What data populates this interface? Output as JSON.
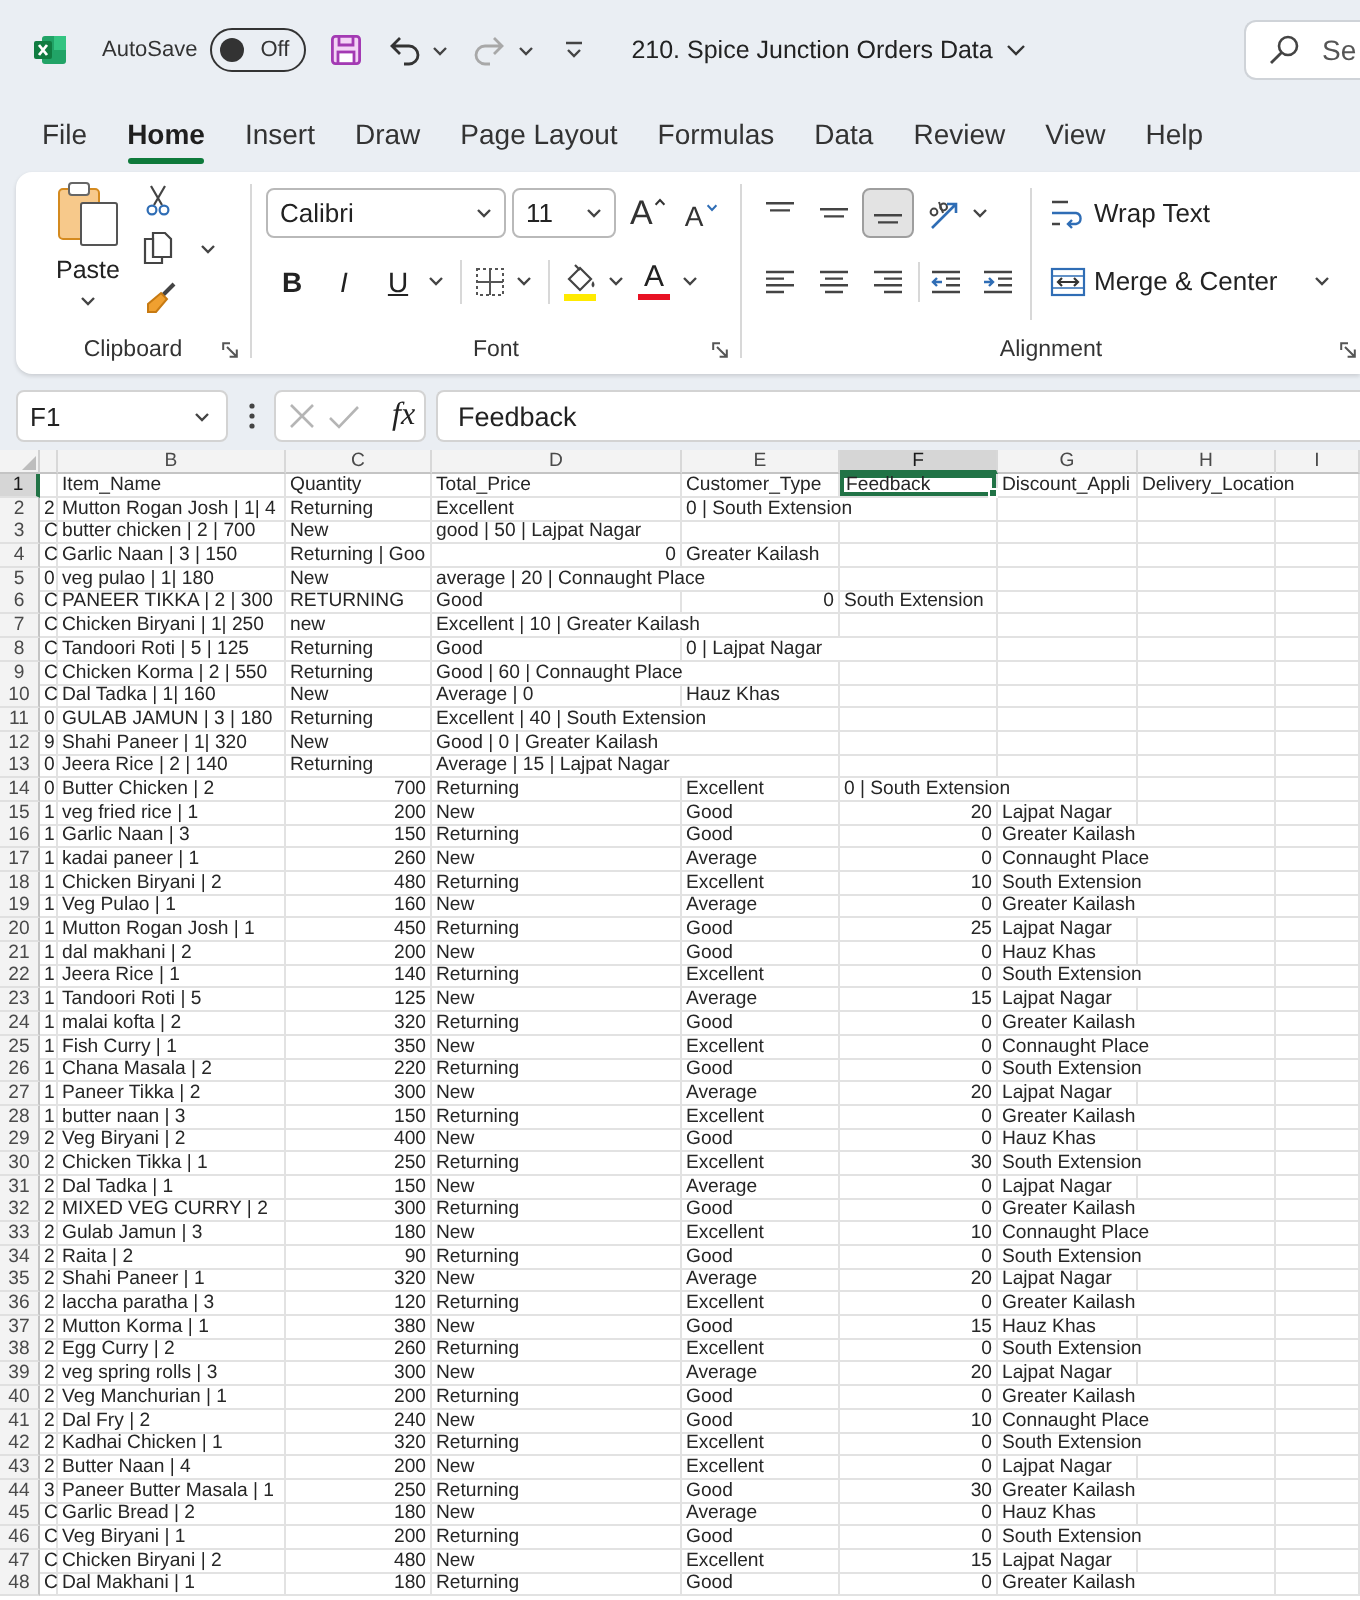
{
  "title_bar": {
    "autosave": {
      "label": "AutoSave",
      "on": false,
      "state_text": "Off"
    },
    "quick_access": [
      {
        "kind": "save",
        "disabled": false
      },
      {
        "kind": "undo",
        "disabled": false
      },
      {
        "kind": "redo",
        "disabled": true
      }
    ],
    "document_title": "210. Spice Junction Orders Data",
    "search": {
      "placeholder": "Se"
    }
  },
  "tabs": [
    {
      "label": "File",
      "selected": false
    },
    {
      "label": "Home",
      "selected": true
    },
    {
      "label": "Insert",
      "selected": false
    },
    {
      "label": "Draw",
      "selected": false
    },
    {
      "label": "Page Layout",
      "selected": false
    },
    {
      "label": "Formulas",
      "selected": false
    },
    {
      "label": "Data",
      "selected": false
    },
    {
      "label": "Review",
      "selected": false
    },
    {
      "label": "View",
      "selected": false
    },
    {
      "label": "Help",
      "selected": false
    }
  ],
  "ribbon": {
    "clipboard": {
      "paste_label": "Paste",
      "group_label": "Clipboard"
    },
    "font": {
      "font_name": "Calibri",
      "font_size": "11",
      "size_buttons": [
        {
          "kind": "grow",
          "label": "A"
        },
        {
          "kind": "shrink",
          "label": "A"
        }
      ],
      "style_buttons": [
        {
          "kind": "bold",
          "label": "B"
        },
        {
          "kind": "italic",
          "label": "I"
        },
        {
          "kind": "underline",
          "label": "U"
        }
      ],
      "font_color_label": "A",
      "group_label": "Font"
    },
    "alignment": {
      "vertical": [
        {
          "kind": "top",
          "selected": false
        },
        {
          "kind": "middle",
          "selected": false
        },
        {
          "kind": "bottom",
          "selected": true
        }
      ],
      "wrap_text": "Wrap Text",
      "merge_center": "Merge & Center",
      "group_label": "Alignment"
    }
  },
  "formula_bar": {
    "name_box": "F1",
    "buttons": [
      {
        "kind": "cancel",
        "disabled": true
      },
      {
        "kind": "enter",
        "disabled": true
      },
      {
        "kind": "function",
        "label": "fx",
        "disabled": false
      }
    ],
    "value": "Feedback"
  },
  "sheet": {
    "columns": [
      {
        "selected": false
      },
      {
        "label": "B",
        "selected": false
      },
      {
        "label": "C",
        "selected": false
      },
      {
        "label": "D",
        "selected": false
      },
      {
        "label": "E",
        "selected": false
      },
      {
        "label": "F",
        "selected": true
      },
      {
        "label": "G",
        "selected": false
      },
      {
        "label": "H",
        "selected": false
      },
      {
        "label": "I",
        "selected": false
      }
    ],
    "rows": [
      {
        "label": "1",
        "selected": true,
        "cells": [
          null,
          {
            "kind": "text",
            "text": "Item_Name"
          },
          {
            "kind": "text",
            "text": "Quantity"
          },
          {
            "kind": "text",
            "text": "Total_Price"
          },
          {
            "kind": "text",
            "text": "Customer_Type"
          },
          {
            "kind": "text",
            "text": "Feedback"
          },
          {
            "kind": "text",
            "text": "Discount_Appli"
          },
          {
            "kind": "text",
            "text": "Delivery_Location"
          }
        ]
      },
      {
        "label": "2",
        "selected": false,
        "cells": [
          {
            "kind": "text",
            "text": "2"
          },
          {
            "kind": "text",
            "text": "Mutton Rogan Josh | 1| 4"
          },
          {
            "kind": "text",
            "text": "Returning"
          },
          {
            "kind": "text",
            "text": "Excellent"
          },
          {
            "kind": "text",
            "text": "0 | South Extension"
          }
        ]
      },
      {
        "label": "3",
        "selected": false,
        "cells": [
          {
            "kind": "text",
            "text": "C"
          },
          {
            "kind": "text",
            "text": "butter chicken | 2 | 700"
          },
          {
            "kind": "text",
            "text": "New"
          },
          {
            "kind": "text",
            "text": "good | 50 | Lajpat Nagar"
          }
        ]
      },
      {
        "label": "4",
        "selected": false,
        "cells": [
          {
            "kind": "text",
            "text": "C"
          },
          {
            "kind": "text",
            "text": "Garlic Naan | 3 | 150"
          },
          {
            "kind": "text",
            "text": "Returning | Goo"
          },
          {
            "kind": "number",
            "text": "0"
          },
          {
            "kind": "text",
            "text": "Greater Kailash"
          }
        ]
      },
      {
        "label": "5",
        "selected": false,
        "cells": [
          {
            "kind": "text",
            "text": "0"
          },
          {
            "kind": "text",
            "text": "veg pulao | 1| 180"
          },
          {
            "kind": "text",
            "text": "New"
          },
          {
            "kind": "text",
            "text": "average | 20 | Connaught Place"
          }
        ]
      },
      {
        "label": "6",
        "selected": false,
        "cells": [
          {
            "kind": "text",
            "text": "C"
          },
          {
            "kind": "text",
            "text": "PANEER TIKKA | 2 | 300"
          },
          {
            "kind": "text",
            "text": "RETURNING"
          },
          {
            "kind": "text",
            "text": "Good"
          },
          {
            "kind": "number",
            "text": "0"
          },
          {
            "kind": "text",
            "text": "South Extension"
          }
        ]
      },
      {
        "label": "7",
        "selected": false,
        "cells": [
          {
            "kind": "text",
            "text": "C"
          },
          {
            "kind": "text",
            "text": "Chicken Biryani | 1| 250"
          },
          {
            "kind": "text",
            "text": "new"
          },
          {
            "kind": "text",
            "text": "Excellent | 10 | Greater Kailash"
          }
        ]
      },
      {
        "label": "8",
        "selected": false,
        "cells": [
          {
            "kind": "text",
            "text": "C"
          },
          {
            "kind": "text",
            "text": "Tandoori Roti | 5 | 125"
          },
          {
            "kind": "text",
            "text": "Returning"
          },
          {
            "kind": "text",
            "text": "Good"
          },
          {
            "kind": "text",
            "text": "0 | Lajpat Nagar"
          }
        ]
      },
      {
        "label": "9",
        "selected": false,
        "cells": [
          {
            "kind": "text",
            "text": "C"
          },
          {
            "kind": "text",
            "text": "Chicken Korma | 2 | 550"
          },
          {
            "kind": "text",
            "text": "Returning"
          },
          {
            "kind": "text",
            "text": "Good | 60 | Connaught Place"
          }
        ]
      },
      {
        "label": "10",
        "selected": false,
        "cells": [
          {
            "kind": "text",
            "text": "C"
          },
          {
            "kind": "text",
            "text": "Dal Tadka | 1| 160"
          },
          {
            "kind": "text",
            "text": "New"
          },
          {
            "kind": "text",
            "text": "Average | 0"
          },
          {
            "kind": "text",
            "text": "Hauz Khas"
          }
        ]
      },
      {
        "label": "11",
        "selected": false,
        "cells": [
          {
            "kind": "text",
            "text": "0"
          },
          {
            "kind": "text",
            "text": "GULAB JAMUN | 3 | 180"
          },
          {
            "kind": "text",
            "text": "Returning"
          },
          {
            "kind": "text",
            "text": "Excellent | 40 | South Extension"
          }
        ]
      },
      {
        "label": "12",
        "selected": false,
        "cells": [
          {
            "kind": "text",
            "text": "9"
          },
          {
            "kind": "text",
            "text": "Shahi Paneer | 1| 320"
          },
          {
            "kind": "text",
            "text": "New"
          },
          {
            "kind": "text",
            "text": "Good | 0 | Greater Kailash"
          }
        ]
      },
      {
        "label": "13",
        "selected": false,
        "cells": [
          {
            "kind": "text",
            "text": "0"
          },
          {
            "kind": "text",
            "text": "Jeera Rice | 2 | 140"
          },
          {
            "kind": "text",
            "text": "Returning"
          },
          {
            "kind": "text",
            "text": "Average | 15 | Lajpat Nagar"
          }
        ]
      },
      {
        "label": "14",
        "selected": false,
        "cells": [
          {
            "kind": "text",
            "text": "0"
          },
          {
            "kind": "text",
            "text": "Butter Chicken | 2"
          },
          {
            "kind": "number",
            "text": "700"
          },
          {
            "kind": "text",
            "text": "Returning"
          },
          {
            "kind": "text",
            "text": "Excellent"
          },
          {
            "kind": "text",
            "text": "0 | South Extension"
          }
        ]
      },
      {
        "label": "15",
        "selected": false,
        "cells": [
          {
            "kind": "text",
            "text": "1"
          },
          {
            "kind": "text",
            "text": "veg fried rice | 1"
          },
          {
            "kind": "number",
            "text": "200"
          },
          {
            "kind": "text",
            "text": "New"
          },
          {
            "kind": "text",
            "text": "Good"
          },
          {
            "kind": "number",
            "text": "20"
          },
          {
            "kind": "text",
            "text": "Lajpat Nagar"
          }
        ]
      },
      {
        "label": "16",
        "selected": false,
        "cells": [
          {
            "kind": "text",
            "text": "1"
          },
          {
            "kind": "text",
            "text": "Garlic Naan | 3"
          },
          {
            "kind": "number",
            "text": "150"
          },
          {
            "kind": "text",
            "text": "Returning"
          },
          {
            "kind": "text",
            "text": "Good"
          },
          {
            "kind": "number",
            "text": "0"
          },
          {
            "kind": "text",
            "text": "Greater Kailash"
          }
        ]
      },
      {
        "label": "17",
        "selected": false,
        "cells": [
          {
            "kind": "text",
            "text": "1"
          },
          {
            "kind": "text",
            "text": "kadai paneer | 1"
          },
          {
            "kind": "number",
            "text": "260"
          },
          {
            "kind": "text",
            "text": "New"
          },
          {
            "kind": "text",
            "text": "Average"
          },
          {
            "kind": "number",
            "text": "0"
          },
          {
            "kind": "text",
            "text": "Connaught Place"
          }
        ]
      },
      {
        "label": "18",
        "selected": false,
        "cells": [
          {
            "kind": "text",
            "text": "1"
          },
          {
            "kind": "text",
            "text": "Chicken Biryani | 2"
          },
          {
            "kind": "number",
            "text": "480"
          },
          {
            "kind": "text",
            "text": "Returning"
          },
          {
            "kind": "text",
            "text": "Excellent"
          },
          {
            "kind": "number",
            "text": "10"
          },
          {
            "kind": "text",
            "text": "South Extension"
          }
        ]
      },
      {
        "label": "19",
        "selected": false,
        "cells": [
          {
            "kind": "text",
            "text": "1"
          },
          {
            "kind": "text",
            "text": "Veg Pulao | 1"
          },
          {
            "kind": "number",
            "text": "160"
          },
          {
            "kind": "text",
            "text": "New"
          },
          {
            "kind": "text",
            "text": "Average"
          },
          {
            "kind": "number",
            "text": "0"
          },
          {
            "kind": "text",
            "text": "Greater Kailash"
          }
        ]
      },
      {
        "label": "20",
        "selected": false,
        "cells": [
          {
            "kind": "text",
            "text": "1"
          },
          {
            "kind": "text",
            "text": "Mutton Rogan Josh | 1"
          },
          {
            "kind": "number",
            "text": "450"
          },
          {
            "kind": "text",
            "text": "Returning"
          },
          {
            "kind": "text",
            "text": "Good"
          },
          {
            "kind": "number",
            "text": "25"
          },
          {
            "kind": "text",
            "text": "Lajpat Nagar"
          }
        ]
      },
      {
        "label": "21",
        "selected": false,
        "cells": [
          {
            "kind": "text",
            "text": "1"
          },
          {
            "kind": "text",
            "text": "dal makhani | 2"
          },
          {
            "kind": "number",
            "text": "200"
          },
          {
            "kind": "text",
            "text": "New"
          },
          {
            "kind": "text",
            "text": "Good"
          },
          {
            "kind": "number",
            "text": "0"
          },
          {
            "kind": "text",
            "text": "Hauz Khas"
          }
        ]
      },
      {
        "label": "22",
        "selected": false,
        "cells": [
          {
            "kind": "text",
            "text": "1"
          },
          {
            "kind": "text",
            "text": "Jeera Rice | 1"
          },
          {
            "kind": "number",
            "text": "140"
          },
          {
            "kind": "text",
            "text": "Returning"
          },
          {
            "kind": "text",
            "text": "Excellent"
          },
          {
            "kind": "number",
            "text": "0"
          },
          {
            "kind": "text",
            "text": "South Extension"
          }
        ]
      },
      {
        "label": "23",
        "selected": false,
        "cells": [
          {
            "kind": "text",
            "text": "1"
          },
          {
            "kind": "text",
            "text": "Tandoori Roti | 5"
          },
          {
            "kind": "number",
            "text": "125"
          },
          {
            "kind": "text",
            "text": "New"
          },
          {
            "kind": "text",
            "text": "Average"
          },
          {
            "kind": "number",
            "text": "15"
          },
          {
            "kind": "text",
            "text": "Lajpat Nagar"
          }
        ]
      },
      {
        "label": "24",
        "selected": false,
        "cells": [
          {
            "kind": "text",
            "text": "1"
          },
          {
            "kind": "text",
            "text": "malai kofta | 2"
          },
          {
            "kind": "number",
            "text": "320"
          },
          {
            "kind": "text",
            "text": "Returning"
          },
          {
            "kind": "text",
            "text": "Good"
          },
          {
            "kind": "number",
            "text": "0"
          },
          {
            "kind": "text",
            "text": "Greater Kailash"
          }
        ]
      },
      {
        "label": "25",
        "selected": false,
        "cells": [
          {
            "kind": "text",
            "text": "1"
          },
          {
            "kind": "text",
            "text": "Fish Curry | 1"
          },
          {
            "kind": "number",
            "text": "350"
          },
          {
            "kind": "text",
            "text": "New"
          },
          {
            "kind": "text",
            "text": "Excellent"
          },
          {
            "kind": "number",
            "text": "0"
          },
          {
            "kind": "text",
            "text": "Connaught Place"
          }
        ]
      },
      {
        "label": "26",
        "selected": false,
        "cells": [
          {
            "kind": "text",
            "text": "1"
          },
          {
            "kind": "text",
            "text": "Chana Masala | 2"
          },
          {
            "kind": "number",
            "text": "220"
          },
          {
            "kind": "text",
            "text": "Returning"
          },
          {
            "kind": "text",
            "text": "Good"
          },
          {
            "kind": "number",
            "text": "0"
          },
          {
            "kind": "text",
            "text": "South Extension"
          }
        ]
      },
      {
        "label": "27",
        "selected": false,
        "cells": [
          {
            "kind": "text",
            "text": "1"
          },
          {
            "kind": "text",
            "text": "Paneer Tikka | 2"
          },
          {
            "kind": "number",
            "text": "300"
          },
          {
            "kind": "text",
            "text": "New"
          },
          {
            "kind": "text",
            "text": "Average"
          },
          {
            "kind": "number",
            "text": "20"
          },
          {
            "kind": "text",
            "text": "Lajpat Nagar"
          }
        ]
      },
      {
        "label": "28",
        "selected": false,
        "cells": [
          {
            "kind": "text",
            "text": "1"
          },
          {
            "kind": "text",
            "text": "butter naan | 3"
          },
          {
            "kind": "number",
            "text": "150"
          },
          {
            "kind": "text",
            "text": "Returning"
          },
          {
            "kind": "text",
            "text": "Excellent"
          },
          {
            "kind": "number",
            "text": "0"
          },
          {
            "kind": "text",
            "text": "Greater Kailash"
          }
        ]
      },
      {
        "label": "29",
        "selected": false,
        "cells": [
          {
            "kind": "text",
            "text": "2"
          },
          {
            "kind": "text",
            "text": "Veg Biryani | 2"
          },
          {
            "kind": "number",
            "text": "400"
          },
          {
            "kind": "text",
            "text": "New"
          },
          {
            "kind": "text",
            "text": "Good"
          },
          {
            "kind": "number",
            "text": "0"
          },
          {
            "kind": "text",
            "text": "Hauz Khas"
          }
        ]
      },
      {
        "label": "30",
        "selected": false,
        "cells": [
          {
            "kind": "text",
            "text": "2"
          },
          {
            "kind": "text",
            "text": "Chicken Tikka | 1"
          },
          {
            "kind": "number",
            "text": "250"
          },
          {
            "kind": "text",
            "text": "Returning"
          },
          {
            "kind": "text",
            "text": "Excellent"
          },
          {
            "kind": "number",
            "text": "30"
          },
          {
            "kind": "text",
            "text": "South Extension"
          }
        ]
      },
      {
        "label": "31",
        "selected": false,
        "cells": [
          {
            "kind": "text",
            "text": "2"
          },
          {
            "kind": "text",
            "text": "Dal Tadka | 1"
          },
          {
            "kind": "number",
            "text": "150"
          },
          {
            "kind": "text",
            "text": "New"
          },
          {
            "kind": "text",
            "text": "Average"
          },
          {
            "kind": "number",
            "text": "0"
          },
          {
            "kind": "text",
            "text": "Lajpat Nagar"
          }
        ]
      },
      {
        "label": "32",
        "selected": false,
        "cells": [
          {
            "kind": "text",
            "text": "2"
          },
          {
            "kind": "text",
            "text": "MIXED VEG CURRY | 2"
          },
          {
            "kind": "number",
            "text": "300"
          },
          {
            "kind": "text",
            "text": "Returning"
          },
          {
            "kind": "text",
            "text": "Good"
          },
          {
            "kind": "number",
            "text": "0"
          },
          {
            "kind": "text",
            "text": "Greater Kailash"
          }
        ]
      },
      {
        "label": "33",
        "selected": false,
        "cells": [
          {
            "kind": "text",
            "text": "2"
          },
          {
            "kind": "text",
            "text": "Gulab Jamun | 3"
          },
          {
            "kind": "number",
            "text": "180"
          },
          {
            "kind": "text",
            "text": "New"
          },
          {
            "kind": "text",
            "text": "Excellent"
          },
          {
            "kind": "number",
            "text": "10"
          },
          {
            "kind": "text",
            "text": "Connaught Place"
          }
        ]
      },
      {
        "label": "34",
        "selected": false,
        "cells": [
          {
            "kind": "text",
            "text": "2"
          },
          {
            "kind": "text",
            "text": "Raita | 2"
          },
          {
            "kind": "number",
            "text": "90"
          },
          {
            "kind": "text",
            "text": "Returning"
          },
          {
            "kind": "text",
            "text": "Good"
          },
          {
            "kind": "number",
            "text": "0"
          },
          {
            "kind": "text",
            "text": "South Extension"
          }
        ]
      },
      {
        "label": "35",
        "selected": false,
        "cells": [
          {
            "kind": "text",
            "text": "2"
          },
          {
            "kind": "text",
            "text": "Shahi Paneer | 1"
          },
          {
            "kind": "number",
            "text": "320"
          },
          {
            "kind": "text",
            "text": "New"
          },
          {
            "kind": "text",
            "text": "Average"
          },
          {
            "kind": "number",
            "text": "20"
          },
          {
            "kind": "text",
            "text": "Lajpat Nagar"
          }
        ]
      },
      {
        "label": "36",
        "selected": false,
        "cells": [
          {
            "kind": "text",
            "text": "2"
          },
          {
            "kind": "text",
            "text": "laccha paratha | 3"
          },
          {
            "kind": "number",
            "text": "120"
          },
          {
            "kind": "text",
            "text": "Returning"
          },
          {
            "kind": "text",
            "text": "Excellent"
          },
          {
            "kind": "number",
            "text": "0"
          },
          {
            "kind": "text",
            "text": "Greater Kailash"
          }
        ]
      },
      {
        "label": "37",
        "selected": false,
        "cells": [
          {
            "kind": "text",
            "text": "2"
          },
          {
            "kind": "text",
            "text": "Mutton Korma | 1"
          },
          {
            "kind": "number",
            "text": "380"
          },
          {
            "kind": "text",
            "text": "New"
          },
          {
            "kind": "text",
            "text": "Good"
          },
          {
            "kind": "number",
            "text": "15"
          },
          {
            "kind": "text",
            "text": "Hauz Khas"
          }
        ]
      },
      {
        "label": "38",
        "selected": false,
        "cells": [
          {
            "kind": "text",
            "text": "2"
          },
          {
            "kind": "text",
            "text": "Egg Curry | 2"
          },
          {
            "kind": "number",
            "text": "260"
          },
          {
            "kind": "text",
            "text": "Returning"
          },
          {
            "kind": "text",
            "text": "Excellent"
          },
          {
            "kind": "number",
            "text": "0"
          },
          {
            "kind": "text",
            "text": "South Extension"
          }
        ]
      },
      {
        "label": "39",
        "selected": false,
        "cells": [
          {
            "kind": "text",
            "text": "2"
          },
          {
            "kind": "text",
            "text": "veg spring rolls | 3"
          },
          {
            "kind": "number",
            "text": "300"
          },
          {
            "kind": "text",
            "text": "New"
          },
          {
            "kind": "text",
            "text": "Average"
          },
          {
            "kind": "number",
            "text": "20"
          },
          {
            "kind": "text",
            "text": "Lajpat Nagar"
          }
        ]
      },
      {
        "label": "40",
        "selected": false,
        "cells": [
          {
            "kind": "text",
            "text": "2"
          },
          {
            "kind": "text",
            "text": "Veg Manchurian | 1"
          },
          {
            "kind": "number",
            "text": "200"
          },
          {
            "kind": "text",
            "text": "Returning"
          },
          {
            "kind": "text",
            "text": "Good"
          },
          {
            "kind": "number",
            "text": "0"
          },
          {
            "kind": "text",
            "text": "Greater Kailash"
          }
        ]
      },
      {
        "label": "41",
        "selected": false,
        "cells": [
          {
            "kind": "text",
            "text": "2"
          },
          {
            "kind": "text",
            "text": "Dal Fry | 2"
          },
          {
            "kind": "number",
            "text": "240"
          },
          {
            "kind": "text",
            "text": "New"
          },
          {
            "kind": "text",
            "text": "Good"
          },
          {
            "kind": "number",
            "text": "10"
          },
          {
            "kind": "text",
            "text": "Connaught Place"
          }
        ]
      },
      {
        "label": "42",
        "selected": false,
        "cells": [
          {
            "kind": "text",
            "text": "2"
          },
          {
            "kind": "text",
            "text": "Kadhai Chicken | 1"
          },
          {
            "kind": "number",
            "text": "320"
          },
          {
            "kind": "text",
            "text": "Returning"
          },
          {
            "kind": "text",
            "text": "Excellent"
          },
          {
            "kind": "number",
            "text": "0"
          },
          {
            "kind": "text",
            "text": "South Extension"
          }
        ]
      },
      {
        "label": "43",
        "selected": false,
        "cells": [
          {
            "kind": "text",
            "text": "2"
          },
          {
            "kind": "text",
            "text": "Butter Naan | 4"
          },
          {
            "kind": "number",
            "text": "200"
          },
          {
            "kind": "text",
            "text": "New"
          },
          {
            "kind": "text",
            "text": "Excellent"
          },
          {
            "kind": "number",
            "text": "0"
          },
          {
            "kind": "text",
            "text": "Lajpat Nagar"
          }
        ]
      },
      {
        "label": "44",
        "selected": false,
        "cells": [
          {
            "kind": "text",
            "text": "3"
          },
          {
            "kind": "text",
            "text": "Paneer Butter Masala | 1"
          },
          {
            "kind": "number",
            "text": "250"
          },
          {
            "kind": "text",
            "text": "Returning"
          },
          {
            "kind": "text",
            "text": "Good"
          },
          {
            "kind": "number",
            "text": "30"
          },
          {
            "kind": "text",
            "text": "Greater Kailash"
          }
        ]
      },
      {
        "label": "45",
        "selected": false,
        "cells": [
          {
            "kind": "text",
            "text": "C"
          },
          {
            "kind": "text",
            "text": "Garlic Bread | 2"
          },
          {
            "kind": "number",
            "text": "180"
          },
          {
            "kind": "text",
            "text": "New"
          },
          {
            "kind": "text",
            "text": "Average"
          },
          {
            "kind": "number",
            "text": "0"
          },
          {
            "kind": "text",
            "text": "Hauz Khas"
          }
        ]
      },
      {
        "label": "46",
        "selected": false,
        "cells": [
          {
            "kind": "text",
            "text": "C"
          },
          {
            "kind": "text",
            "text": "Veg Biryani | 1"
          },
          {
            "kind": "number",
            "text": "200"
          },
          {
            "kind": "text",
            "text": "Returning"
          },
          {
            "kind": "text",
            "text": "Good"
          },
          {
            "kind": "number",
            "text": "0"
          },
          {
            "kind": "text",
            "text": "South Extension"
          }
        ]
      },
      {
        "label": "47",
        "selected": false,
        "cells": [
          {
            "kind": "text",
            "text": "C"
          },
          {
            "kind": "text",
            "text": "Chicken Biryani | 2"
          },
          {
            "kind": "number",
            "text": "480"
          },
          {
            "kind": "text",
            "text": "New"
          },
          {
            "kind": "text",
            "text": "Excellent"
          },
          {
            "kind": "number",
            "text": "15"
          },
          {
            "kind": "text",
            "text": "Lajpat Nagar"
          }
        ]
      },
      {
        "label": "48",
        "selected": false,
        "cells": [
          {
            "kind": "text",
            "text": "C"
          },
          {
            "kind": "text",
            "text": "Dal Makhani | 1"
          },
          {
            "kind": "number",
            "text": "180"
          },
          {
            "kind": "text",
            "text": "Returning"
          },
          {
            "kind": "text",
            "text": "Good"
          },
          {
            "kind": "number",
            "text": "0"
          },
          {
            "kind": "text",
            "text": "Greater Kailash"
          }
        ]
      }
    ]
  }
}
